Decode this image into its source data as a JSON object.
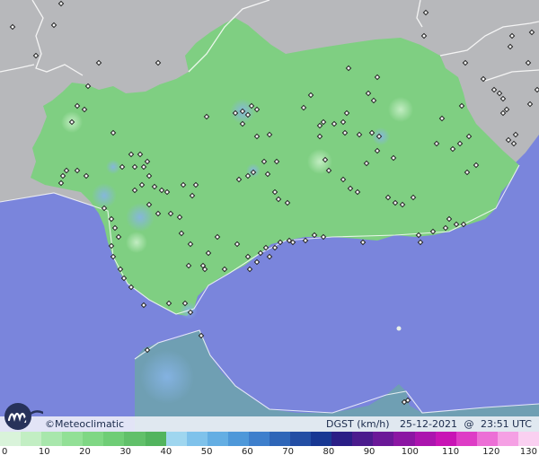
{
  "map": {
    "brand_text": "©Meteoclimatic",
    "variable": "DGST (km/h)",
    "date": "25-12-2021",
    "time_separator": "@",
    "time": "23:51 UTC",
    "colors": {
      "sea": "#7a85dc",
      "land_outside": "#b7b8bb",
      "land_main": "#7fcf82",
      "land_north_africa": "#6fa0b0",
      "station_marker": "#222222"
    }
  },
  "scale": {
    "labels": [
      "0",
      "10",
      "20",
      "30",
      "40",
      "50",
      "60",
      "70",
      "80",
      "90",
      "100",
      "110",
      "120",
      "130"
    ],
    "colors": [
      "#d9f3da",
      "#c2eec3",
      "#a8e7ac",
      "#92e096",
      "#7fd784",
      "#6fcd76",
      "#61c06a",
      "#52b45e",
      "#9fd6ef",
      "#7fc2eb",
      "#64aee3",
      "#4e98d9",
      "#3e7fcc",
      "#2f66b8",
      "#234ea4",
      "#183893",
      "#2a1e86",
      "#4b1b8d",
      "#6b1898",
      "#8b16a3",
      "#ab14ae",
      "#c814b5",
      "#de3cc6",
      "#ec6fd6",
      "#f5a0e4",
      "#fad0f1"
    ]
  }
}
